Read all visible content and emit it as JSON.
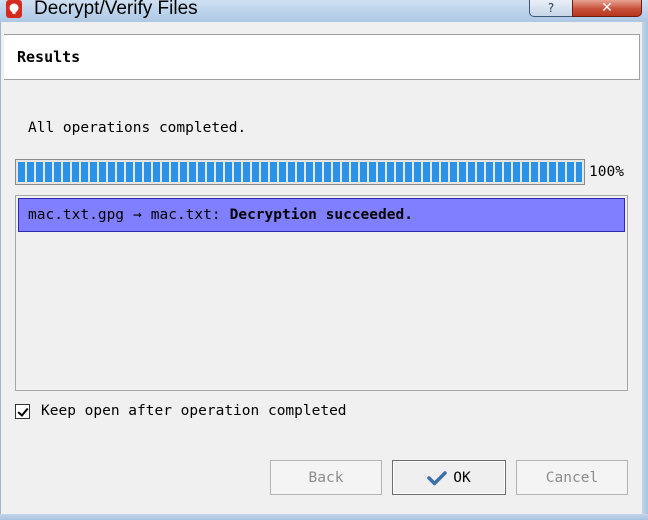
{
  "window": {
    "title": "Decrypt/Verify Files",
    "help_glyph": "?",
    "close_glyph": "✕"
  },
  "header": {
    "title": "Results"
  },
  "status": {
    "message": "All operations completed."
  },
  "progress": {
    "value": 1.0,
    "label": "100%"
  },
  "results": [
    {
      "source": "mac.txt.gpg",
      "arrow": "→",
      "target": "mac.txt:",
      "outcome": "Decryption succeeded."
    }
  ],
  "options": {
    "keep_open_label": "Keep open after operation completed",
    "keep_open_checked": true
  },
  "buttons": {
    "back": "Back",
    "ok": "OK",
    "cancel": "Cancel"
  },
  "colors": {
    "selection": "#7f7fff",
    "progress": "#2a93e8",
    "ok_check": "#3d6fa8"
  },
  "icons": {
    "app": "gpg4win-app-icon",
    "ok": "checkmark-icon"
  }
}
